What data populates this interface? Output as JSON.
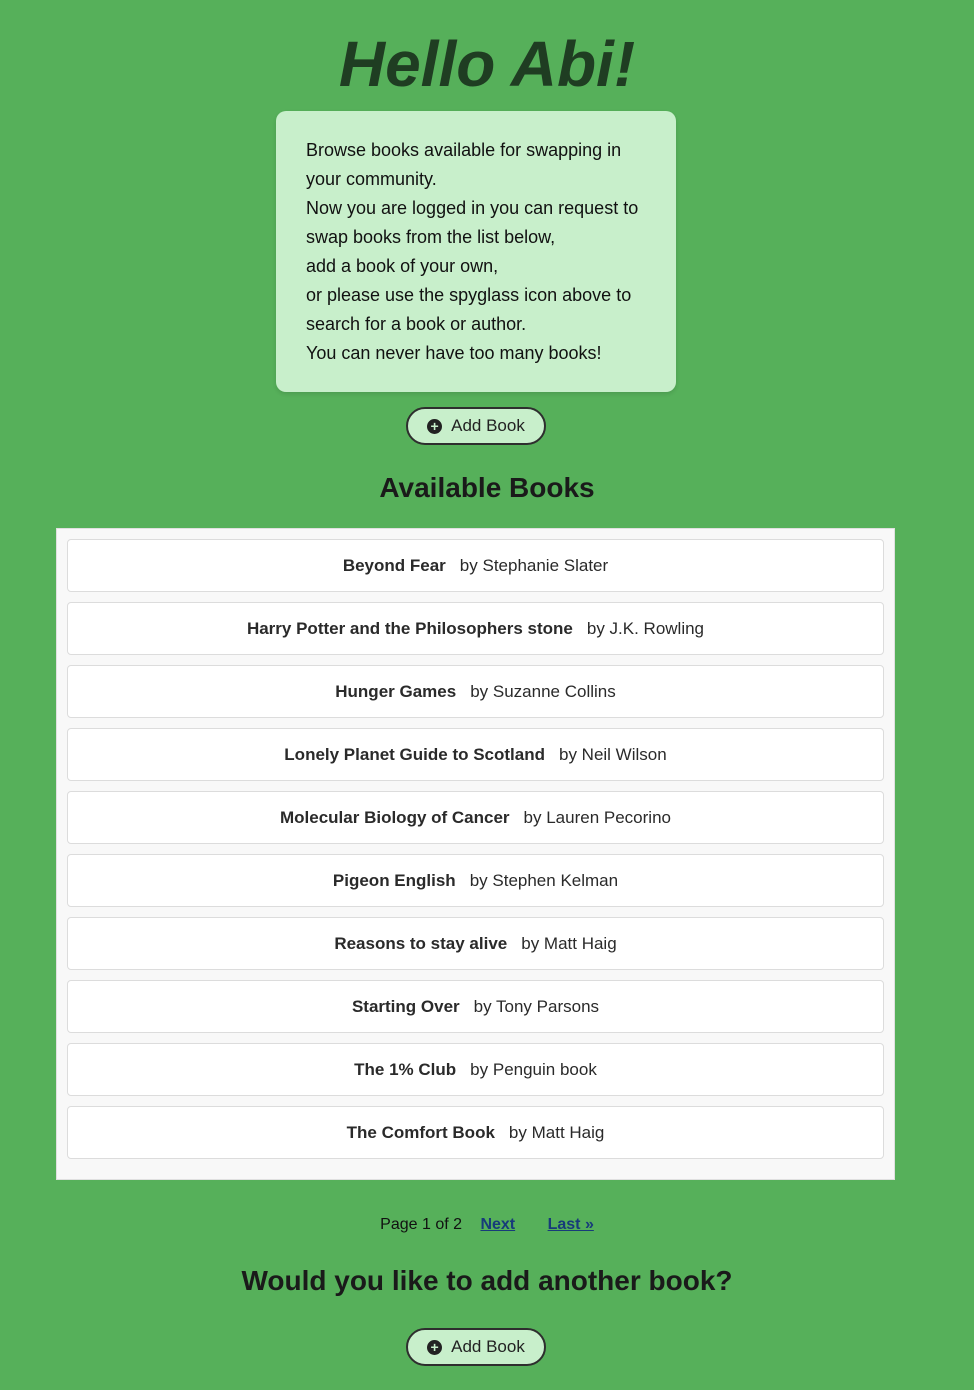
{
  "greeting": "Hello Abi!",
  "intro": {
    "lines": [
      "Browse books available for swapping in your community.",
      "Now you are logged in you can request to swap books from the list below,",
      "add a book of your own,",
      "or please use the spyglass icon above to search for a book or author.",
      "You can never have too many books!"
    ]
  },
  "add_button": {
    "label": "Add Book",
    "icon": "plus-circle-icon"
  },
  "available_title": "Available Books",
  "books": [
    {
      "title": "Beyond Fear",
      "author": "by Stephanie Slater"
    },
    {
      "title": "Harry Potter and the Philosophers stone",
      "author": "by J.K. Rowling"
    },
    {
      "title": "Hunger Games",
      "author": "by Suzanne Collins"
    },
    {
      "title": "Lonely Planet Guide to Scotland",
      "author": "by Neil Wilson"
    },
    {
      "title": "Molecular Biology of Cancer",
      "author": "by Lauren Pecorino"
    },
    {
      "title": "Pigeon English",
      "author": "by Stephen Kelman"
    },
    {
      "title": "Reasons to stay alive",
      "author": "by Matt Haig"
    },
    {
      "title": "Starting Over",
      "author": "by Tony Parsons"
    },
    {
      "title": "The 1% Club",
      "author": "by Penguin book"
    },
    {
      "title": "The Comfort Book",
      "author": "by Matt Haig"
    }
  ],
  "pagination": {
    "status": "Page 1 of 2",
    "next": "Next",
    "last": "Last »"
  },
  "add_another_title": "Would you like to add another book?",
  "colors": {
    "background": "#56b05a",
    "panel": "#c8efcb",
    "link": "#173b7a"
  }
}
